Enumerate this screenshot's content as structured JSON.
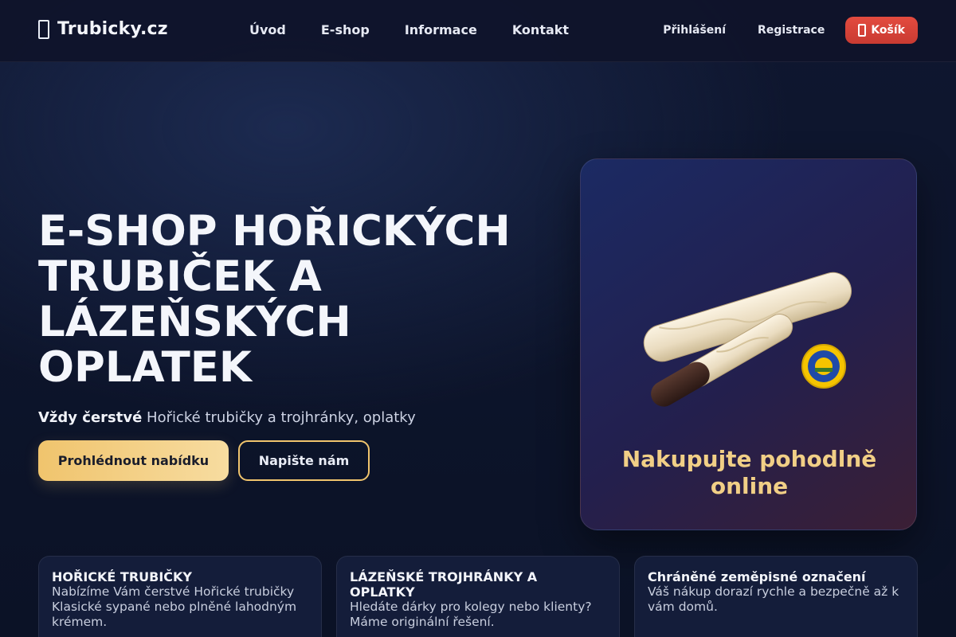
{
  "header": {
    "brand": "Trubicky.cz",
    "nav": [
      "Úvod",
      "E-shop",
      "Informace",
      "Kontakt"
    ],
    "login": "Přihlášení",
    "register": "Registrace",
    "cart": "Košík"
  },
  "hero": {
    "title_lines": [
      "E-SHOP HOŘICKÝCH",
      "TRUBIČEK A",
      "LÁZEŇSKÝCH",
      "OPLATEK"
    ],
    "subtitle_strong": "Vždy čerstvé",
    "subtitle_rest": " Hořické trubičky a trojhránky, oplatky",
    "cta_primary": "Prohlédnout nabídku",
    "cta_secondary": "Napište nám"
  },
  "promo": {
    "text": "Nakupujte pohodlně online"
  },
  "features": [
    {
      "title": "HOŘICKÉ TRUBIČKY",
      "text": "Nabízíme Vám čerstvé Hořické trubičky Klasické sypané nebo plněné lahodným krémem."
    },
    {
      "title": "LÁZEŇSKÉ TROJHRÁNKY A OPLATKY",
      "text": "Hledáte dárky pro kolegy nebo klienty? Máme originální řešení."
    },
    {
      "title": "Chráněné zeměpisné označení",
      "text": "Váš nákup dorazí rychle a bezpečně až k vám domů."
    }
  ],
  "colors": {
    "accent_gold": "#f0c46d",
    "cart_red": "#e34b3f",
    "bg_dark": "#0f1730"
  }
}
